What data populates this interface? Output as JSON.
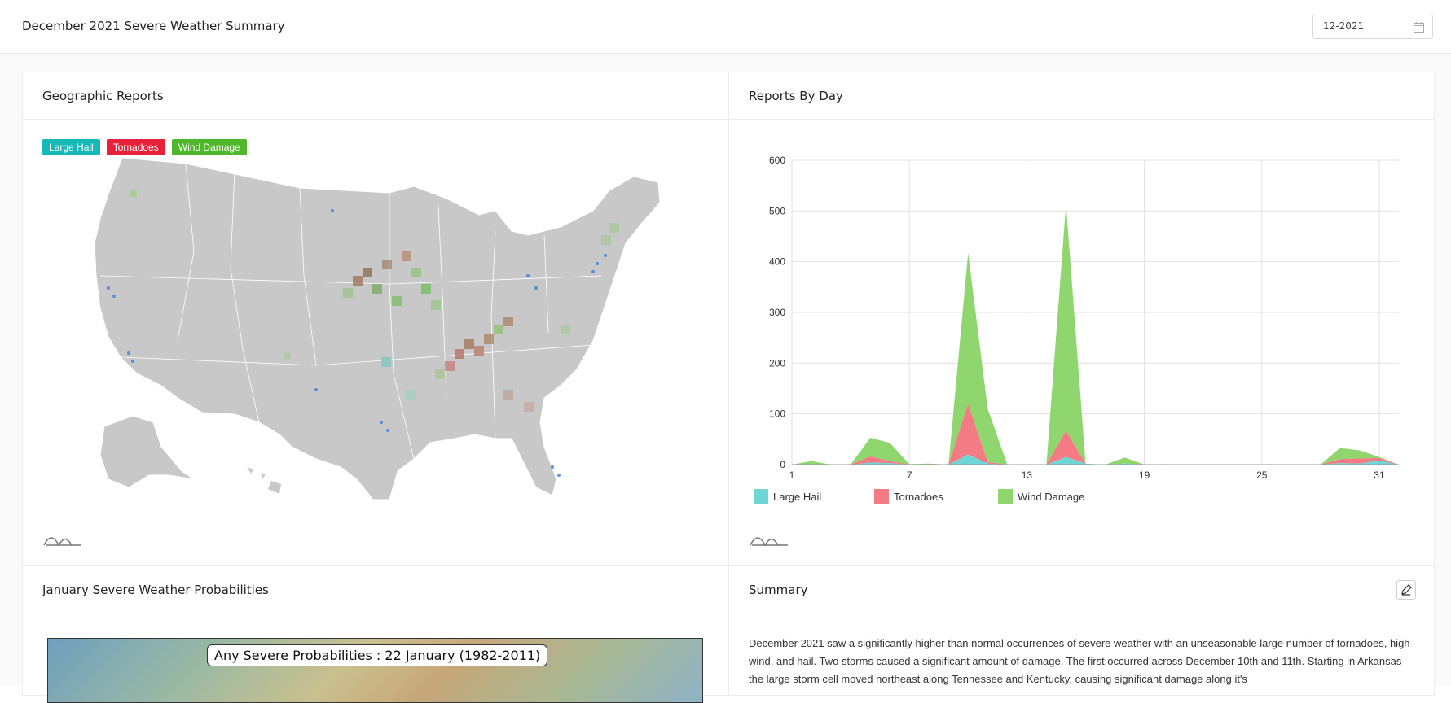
{
  "header": {
    "title": "December 2021 Severe Weather Summary",
    "month_value": "12-2021"
  },
  "panels": {
    "geo": {
      "title": "Geographic Reports"
    },
    "day": {
      "title": "Reports By Day"
    },
    "prob": {
      "title": "January Severe Weather Probabilities",
      "image_label": "Any Severe Probabilities : 22 January (1982-2011)"
    },
    "summary": {
      "title": "Summary",
      "text": "December 2021 saw a significantly higher than normal occurrences of severe weather with an unseasonable large number of tornadoes, high wind, and hail. Two storms caused a significant amount of damage. The first occurred across December 10th and 11th. Starting in Arkansas the large storm cell moved northeast along Tennessee and Kentucky, causing significant damage along it's"
    }
  },
  "map_legend": [
    {
      "label": "Large Hail",
      "color": "#17b8b8"
    },
    {
      "label": "Tornadoes",
      "color": "#e8213a"
    },
    {
      "label": "Wind Damage",
      "color": "#4fb82a"
    }
  ],
  "icons": {
    "calendar": "calendar-icon",
    "edit": "pencil-icon",
    "logo": "wave-logo-icon"
  },
  "chart_data": {
    "type": "area",
    "stacked": true,
    "x": [
      1,
      2,
      3,
      4,
      5,
      6,
      7,
      8,
      9,
      10,
      11,
      12,
      13,
      14,
      15,
      16,
      17,
      18,
      19,
      20,
      21,
      22,
      23,
      24,
      25,
      26,
      27,
      28,
      29,
      30,
      31,
      32
    ],
    "xticks": [
      1,
      7,
      13,
      19,
      25,
      31
    ],
    "ylim": [
      0,
      600
    ],
    "yticks": [
      0,
      100,
      200,
      300,
      400,
      500,
      600
    ],
    "grid": true,
    "legend_position": "bottom-left",
    "series": [
      {
        "name": "Large Hail",
        "color": "#6fd6d6",
        "values": [
          0,
          1,
          0,
          0,
          4,
          3,
          0,
          0,
          0,
          20,
          2,
          0,
          0,
          0,
          15,
          2,
          0,
          2,
          0,
          0,
          0,
          0,
          0,
          0,
          0,
          0,
          0,
          0,
          3,
          2,
          8,
          0
        ]
      },
      {
        "name": "Tornadoes",
        "color": "#f47a84",
        "values": [
          0,
          0,
          0,
          0,
          12,
          4,
          0,
          0,
          0,
          100,
          3,
          0,
          0,
          0,
          52,
          0,
          0,
          0,
          0,
          1,
          0,
          0,
          0,
          0,
          0,
          0,
          0,
          0,
          8,
          10,
          5,
          0
        ]
      },
      {
        "name": "Wind Damage",
        "color": "#8fd66f",
        "values": [
          0,
          6,
          0,
          0,
          37,
          36,
          1,
          2,
          0,
          297,
          105,
          0,
          0,
          0,
          447,
          0,
          0,
          12,
          0,
          0,
          0,
          0,
          0,
          0,
          0,
          0,
          0,
          0,
          22,
          16,
          2,
          0
        ]
      }
    ]
  }
}
